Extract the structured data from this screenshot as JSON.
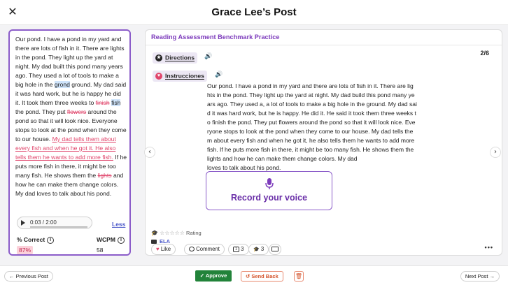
{
  "header": {
    "title": "Grace Lee’s Post",
    "close_glyph": "✕"
  },
  "left_panel": {
    "passage_segments": [
      {
        "t": "Our pond. I have a pond in my yard and there are lots of fish in it. There are lights in the pond. They light up the yard at night. My dad built this pond many years ago. They used a lot of tools to make a big hole in the ",
        "s": "normal"
      },
      {
        "t": "grond",
        "s": "highlight"
      },
      {
        "t": " ground. My dad said it was hard work, but he is happy he did it. It took them three weeks to ",
        "s": "normal"
      },
      {
        "t": "finish",
        "s": "strike"
      },
      {
        "t": " ",
        "s": "normal"
      },
      {
        "t": "fish",
        "s": "highlight"
      },
      {
        "t": " the pond. They put ",
        "s": "normal"
      },
      {
        "t": "flowers",
        "s": "strike"
      },
      {
        "t": " around the pond so that it will look nice. Everyone stops to look at the pond when they come to our house. ",
        "s": "normal"
      },
      {
        "t": "My dad tells them about every fish and when he got it. He also tells them he wants to add more fish.",
        "s": "underline"
      },
      {
        "t": " If he puts more fish in there, it might be too many fish. He shows them the ",
        "s": "normal"
      },
      {
        "t": "lights",
        "s": "strike"
      },
      {
        "t": " and how he can make them change colors. My dad loves to talk about his pond.",
        "s": "normal"
      }
    ],
    "audio": {
      "time": "0:03 / 2:00",
      "progress": 0.025
    },
    "less_label": "Less",
    "correct_label": "% Correct",
    "correct_value": "87%",
    "wcpm_label": "WCPM",
    "wcpm_value": "58"
  },
  "right_panel": {
    "card_title": "Reading Assessment Benchmark Practice",
    "page_indicator": "2/6",
    "directions_label": "Directions",
    "instrucciones_label": "Instrucciones",
    "passage_lines": [
      "Our pond. I have a pond in my yard and there are lots of fish in it. There are lig",
      "hts in the pond. They light up the yard at night. My dad build this pond many ye",
      "ars ago. They used a, a lot of tools to make a big hole in the ground. My dad sai",
      "d it was hard work, but he is happy. He did it. He said it took them three weeks t",
      "o finish the pond. They put flowers around the pond so that it will look nice. Eve",
      "ryone stops to look at the pond when they come to our house. My dad tells the",
      "m about every fish and when he got it, he also tells them he wants to add more",
      "fish. If he puts more fish in there, it might be too many fish. He shows them the",
      "lights and how he can make them change colors. My dad",
      "loves to talk about his pond."
    ],
    "record_label": "Record your voice",
    "rating_label": "Rating",
    "rating_value": 0,
    "subject": "ELA",
    "like_label": "Like",
    "comment_label": "Comment",
    "comment_count": "3",
    "views_count": "3"
  },
  "footer": {
    "prev_label": "Previous Post",
    "approve_label": "Approve",
    "send_back_label": "Send Back",
    "next_label": "Next Post"
  },
  "colors": {
    "accent_purple": "#8b5cc9",
    "approve_green": "#22833a",
    "send_back_orange": "#d4542c",
    "error_pink": "#e0456b",
    "highlight_blue": "#cfe4fb"
  }
}
